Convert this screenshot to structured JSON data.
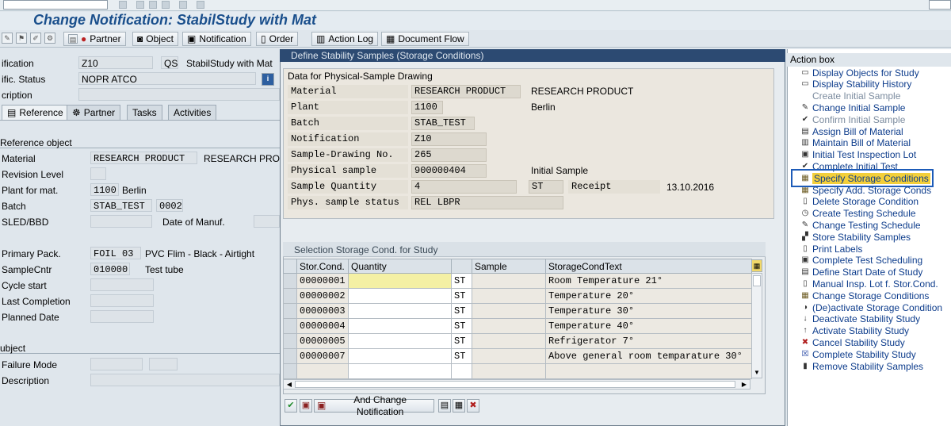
{
  "window": {
    "title": "Change Notification: StabilStudy with Mat"
  },
  "toolbar": {
    "buttons": [
      {
        "label": "Partner",
        "icon": "partner-icon"
      },
      {
        "label": "Object",
        "icon": "object-icon"
      },
      {
        "label": "Notification",
        "icon": "notification-icon"
      },
      {
        "label": "Order",
        "icon": "order-icon"
      },
      {
        "label": "Action Log",
        "icon": "action-log-icon"
      },
      {
        "label": "Document Flow",
        "icon": "document-flow-icon"
      }
    ]
  },
  "header": {
    "notification_label": "ification",
    "notification_value": "Z10",
    "notification_type": "QS",
    "notification_desc": "StabilStudy with Mat",
    "status_label": "ific. Status",
    "status_value": "NOPR ATCO",
    "description_label": "cription"
  },
  "tabs": [
    {
      "label": "Reference",
      "icon": "reference-icon",
      "active": true
    },
    {
      "label": "Partner",
      "icon": "partner-icon",
      "active": false
    },
    {
      "label": "Tasks",
      "icon": "",
      "active": false
    },
    {
      "label": "Activities",
      "icon": "",
      "active": false
    }
  ],
  "reference": {
    "group_title": "Reference object",
    "material_label": "Material",
    "material_value": "RESEARCH PRODUCT",
    "material_desc": "RESEARCH PRODU",
    "revision_label": "Revision Level",
    "plant_label": "Plant for mat.",
    "plant_value": "1100",
    "plant_desc": "Berlin",
    "batch_label": "Batch",
    "batch_value": "STAB_TEST",
    "batch_extra": "0002",
    "sled_label": "SLED/BBD",
    "manuf_label": "Date of Manuf.",
    "primary_pack_label": "Primary Pack.",
    "primary_pack_value": "FOIL 03",
    "primary_pack_desc": "PVC Flim - Black - Airtight",
    "sample_cntr_label": "SampleCntr",
    "sample_cntr_value": "010000",
    "sample_cntr_desc": "Test tube",
    "cycle_start_label": "Cycle start",
    "last_completion_label": "Last Completion",
    "planned_date_label": "Planned Date",
    "subject_title": "ubject",
    "failure_mode_label": "Failure Mode",
    "description_label": "Description"
  },
  "dialog": {
    "title": "Define Stability Samples (Storage Conditions)",
    "group1_title": "Data for Physical-Sample Drawing",
    "fields": {
      "material_label": "Material",
      "material_value": "RESEARCH PRODUCT",
      "material_desc": "RESEARCH PRODUCT",
      "plant_label": "Plant",
      "plant_value": "1100",
      "plant_desc": "Berlin",
      "batch_label": "Batch",
      "batch_value": "STAB_TEST",
      "notification_label": "Notification",
      "notification_value": "Z10",
      "sample_drawing_label": "Sample-Drawing No.",
      "sample_drawing_value": "265",
      "physical_sample_label": "Physical sample",
      "physical_sample_value": "900000404",
      "physical_sample_desc": "Initial Sample",
      "sample_qty_label": "Sample Quantity",
      "sample_qty_value": "4",
      "sample_qty_unit": "ST",
      "receipt_label": "Receipt",
      "receipt_value": "13.10.2016",
      "status_label": "Phys. sample status",
      "status_value": "REL  LBPR"
    },
    "group2_title": "Selection Storage Cond. for Study",
    "columns": [
      "Stor.Cond.",
      "Quantity",
      "",
      "Sample",
      "StorageCondText"
    ],
    "rows": [
      {
        "cond": "00000001",
        "qty": "",
        "unit": "ST",
        "sample": "",
        "text": "Room Temperature 21°"
      },
      {
        "cond": "00000002",
        "qty": "",
        "unit": "ST",
        "sample": "",
        "text": "Temperature 20°"
      },
      {
        "cond": "00000003",
        "qty": "",
        "unit": "ST",
        "sample": "",
        "text": "Temperature 30°"
      },
      {
        "cond": "00000004",
        "qty": "",
        "unit": "ST",
        "sample": "",
        "text": "Temperature 40°"
      },
      {
        "cond": "00000005",
        "qty": "",
        "unit": "ST",
        "sample": "",
        "text": "Refrigerator 7°"
      },
      {
        "cond": "00000007",
        "qty": "",
        "unit": "ST",
        "sample": "",
        "text": "Above general room temparature 30°"
      }
    ],
    "bottom_button_label": "And Change Notification"
  },
  "action_box": {
    "title": "Action box",
    "items": [
      {
        "label": "Display Objects for Study",
        "icon": "display-icon",
        "disabled": false,
        "highlight": false
      },
      {
        "label": "Display Stability History",
        "icon": "history-icon",
        "disabled": false,
        "highlight": false
      },
      {
        "label": "Create Initial Sample",
        "icon": "",
        "disabled": true,
        "highlight": false
      },
      {
        "label": "Change Initial Sample",
        "icon": "pencil-icon",
        "disabled": false,
        "highlight": false
      },
      {
        "label": "Confirm Initial Sample",
        "icon": "confirm-icon",
        "disabled": true,
        "highlight": false
      },
      {
        "label": "Assign Bill of Material",
        "icon": "assign-icon",
        "disabled": false,
        "highlight": false
      },
      {
        "label": "Maintain Bill of Material",
        "icon": "bom-icon",
        "disabled": false,
        "highlight": false
      },
      {
        "label": "Initial Test Inspection Lot",
        "icon": "inspection-icon",
        "disabled": false,
        "highlight": false
      },
      {
        "label": "Complete Initial Test",
        "icon": "complete-icon",
        "disabled": false,
        "highlight": false
      },
      {
        "label": "Specify Storage Conditions",
        "icon": "table-icon",
        "disabled": false,
        "highlight": true
      },
      {
        "label": "Specify Add. Storage Conds",
        "icon": "table-icon",
        "disabled": false,
        "highlight": false
      },
      {
        "label": "Delete Storage Condition",
        "icon": "doc-icon",
        "disabled": false,
        "highlight": false
      },
      {
        "label": "Create Testing Schedule",
        "icon": "clock-icon",
        "disabled": false,
        "highlight": false
      },
      {
        "label": "Change Testing Schedule",
        "icon": "pencil-icon",
        "disabled": false,
        "highlight": false
      },
      {
        "label": "Store Stability Samples",
        "icon": "store-icon",
        "disabled": false,
        "highlight": false
      },
      {
        "label": "Print Labels",
        "icon": "doc-icon",
        "disabled": false,
        "highlight": false
      },
      {
        "label": "Complete Test Scheduling",
        "icon": "lock-icon",
        "disabled": false,
        "highlight": false
      },
      {
        "label": "Define Start Date of Study",
        "icon": "calendar-icon",
        "disabled": false,
        "highlight": false
      },
      {
        "label": "Manual Insp. Lot f. Stor.Cond.",
        "icon": "doc-icon",
        "disabled": false,
        "highlight": false
      },
      {
        "label": "Change Storage Conditions",
        "icon": "table-icon",
        "disabled": false,
        "highlight": false
      },
      {
        "label": "(De)activate Storage Condition",
        "icon": "toggle-icon",
        "disabled": false,
        "highlight": false
      },
      {
        "label": "Deactivate Stability Study",
        "icon": "deactivate-icon",
        "disabled": false,
        "highlight": false
      },
      {
        "label": "Activate Stability Study",
        "icon": "activate-icon",
        "disabled": false,
        "highlight": false
      },
      {
        "label": "Cancel Stability Study",
        "icon": "cancel-icon",
        "disabled": false,
        "highlight": false
      },
      {
        "label": "Complete Stability Study",
        "icon": "complete-study-icon",
        "disabled": false,
        "highlight": false
      },
      {
        "label": "Remove Stability Samples",
        "icon": "trash-icon",
        "disabled": false,
        "highlight": false
      }
    ]
  }
}
